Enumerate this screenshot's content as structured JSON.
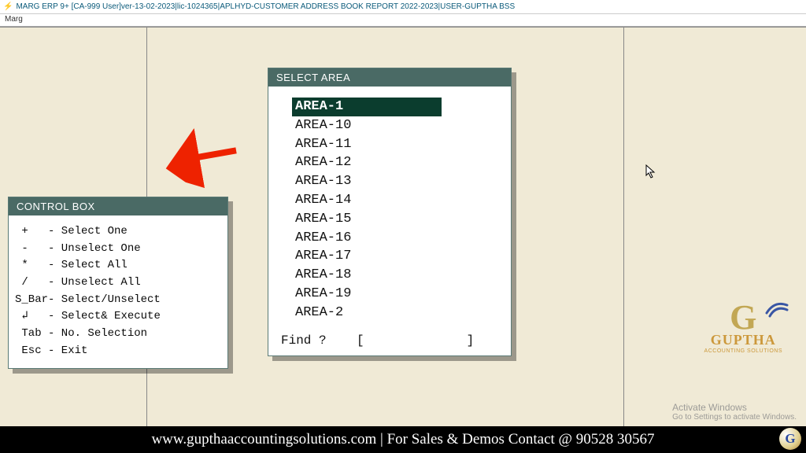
{
  "titlebar": {
    "logo": "⚡",
    "text": "MARG ERP 9+ [CA-999 User]ver-13-02-2023|lic-1024365|APLHYD-CUSTOMER ADDRESS BOOK REPORT 2022-2023|USER-GUPTHA BSS"
  },
  "menubar": {
    "item": "Marg"
  },
  "control_box": {
    "title": "CONTROL BOX",
    "lines": [
      " +   - Select One",
      " -   - Unselect One",
      " *   - Select All",
      " /   - Unselect All",
      "S_Bar- Select/Unselect",
      " ↲   - Select& Execute",
      " Tab - No. Selection",
      " Esc - Exit"
    ]
  },
  "select_area": {
    "title": "SELECT AREA",
    "items": [
      "AREA-1",
      "AREA-10",
      "AREA-11",
      "AREA-12",
      "AREA-13",
      "AREA-14",
      "AREA-15",
      "AREA-16",
      "AREA-17",
      "AREA-18",
      "AREA-19",
      "AREA-2"
    ],
    "selected_index": 0,
    "find_label": "Find ?",
    "find_value": ""
  },
  "watermark": {
    "g": "G",
    "name": "GUPTHA",
    "sub": "ACCOUNTING SOLUTIONS"
  },
  "activate": {
    "line1": "Activate Windows",
    "line2": "Go to Settings to activate Windows."
  },
  "footer": {
    "text": "www.gupthaaccountingsolutions.com | For Sales & Demos Contact @ 90528 30567",
    "badge": "G"
  }
}
